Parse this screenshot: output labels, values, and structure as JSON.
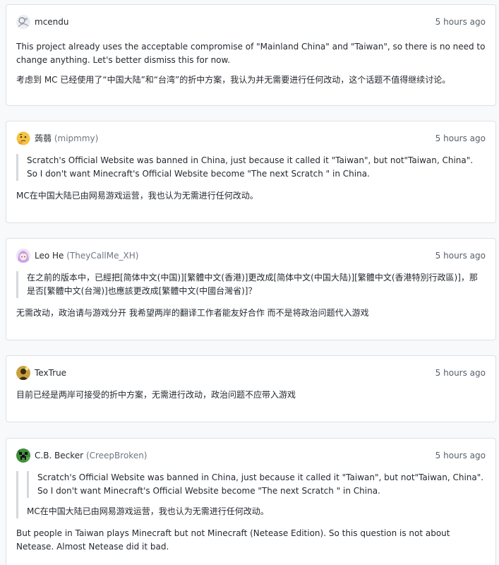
{
  "comments": [
    {
      "author": "mcendu",
      "handle": "",
      "time": "5 hours ago",
      "body": [
        "This project already uses the acceptable compromise of \"Mainland China\" and \"Taiwan\", so there is no need to change anything. Let's better dismiss this for now.",
        "考虑到 MC 已经使用了“中国大陆”和“台湾”的折中方案，我认为并无需要进行任何改动，这个话题不值得继续讨论。"
      ]
    },
    {
      "author": "蒟蒻",
      "handle": "(mipmmy)",
      "time": "5 hours ago",
      "quote": "Scratch's Official Website was banned in China, just because it called it \"Taiwan\", but not\"Taiwan, China\". So I don't want Minecraft's Official Website become \"The next Scratch \" in China.",
      "body": [
        "MC在中国大陆已由网易游戏运营，我也认为无需进行任何改动。"
      ]
    },
    {
      "author": "Leo He",
      "handle": "(TheyCallMe_XH)",
      "time": "5 hours ago",
      "quote": "在之前的版本中，已經把[简体中文(中国)][繁體中文(香港)]更改成[简体中文(中国大陆)][繁體中文(香港特別行政區)]，那是否[繁體中文(台灣)]也應該更改成[繁體中文(中國台灣省)]？",
      "body": [
        "无需改动，政治请与游戏分开 我希望两岸的翻译工作者能友好合作 而不是将政治问题代入游戏"
      ]
    },
    {
      "author": "TexTrue",
      "handle": "",
      "time": "5 hours ago",
      "body": [
        "目前已经是两岸可接受的折中方案，无需进行改动，政治问题不应带入游戏"
      ]
    },
    {
      "author": "C.B. Becker",
      "handle": "(CreepBroken)",
      "time": "5 hours ago",
      "quote": "Scratch's Official Website was banned in China, just because it called it \"Taiwan\", but not\"Taiwan, China\". So I don't want Minecraft's Official Website become \"The next Scratch \" in China.",
      "quote2": "MC在中国大陆已由网易游戏运营，我也认为无需进行任何改动。",
      "body": [
        "But people in Taiwan plays Minecraft but not Minecraft (Netease Edition). So this question is not about Netease. Almost Netease did it bad."
      ]
    }
  ]
}
